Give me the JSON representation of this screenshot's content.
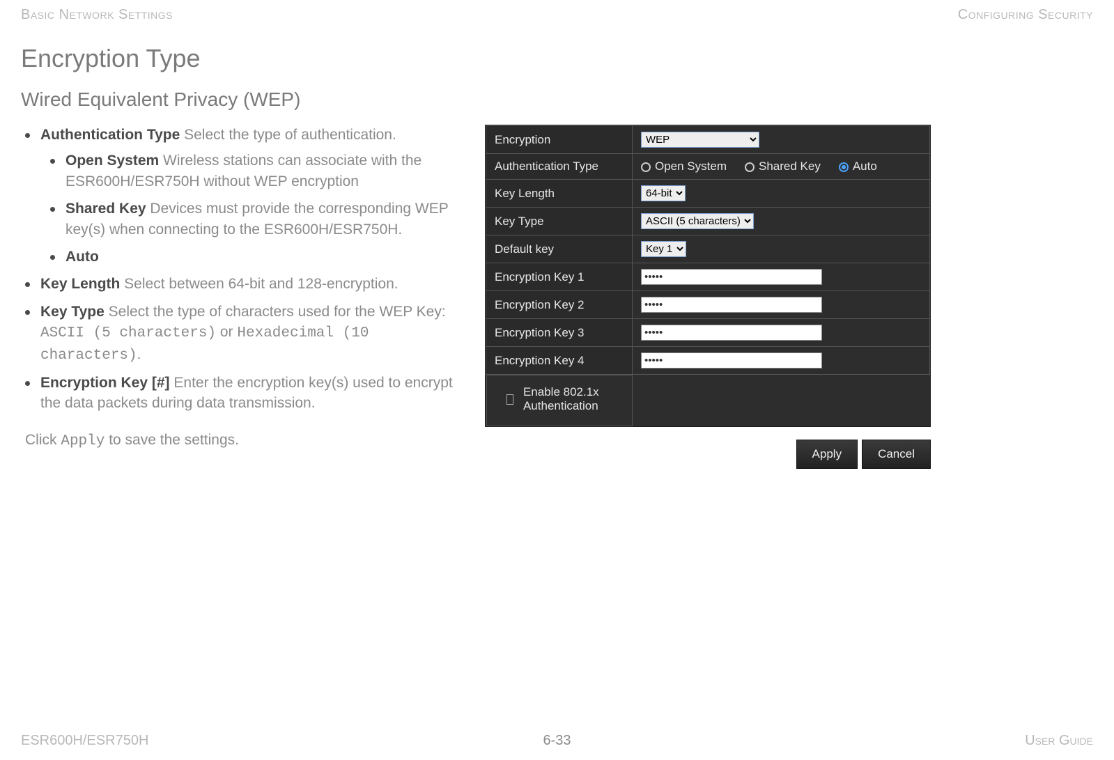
{
  "header": {
    "left": "Basic Network Settings",
    "right": "Configuring Security"
  },
  "title": "Encryption Type",
  "subtitle": "Wired Equivalent Privacy (WEP)",
  "bullets": {
    "auth_type": {
      "term": "Authentication Type",
      "desc": "  Select the type of authentication."
    },
    "open_system": {
      "term": "Open System",
      "desc": "  Wireless stations can associate with the ESR600H/ESR750H without WEP encryption"
    },
    "shared_key": {
      "term": "Shared Key",
      "desc": "  Devices must provide the corresponding WEP key(s) when connecting to the ESR600H/ESR750H."
    },
    "auto": {
      "term": "Auto"
    },
    "key_length": {
      "term": "Key Length",
      "desc": "  Select between 64-bit and 128-encryption."
    },
    "key_type": {
      "term": "Key Type",
      "desc_pre": "  Select the type of characters used for the WEP Key: ",
      "mono1": "ASCII (5 characters)",
      "mid": " or ",
      "mono2": "Hexadecimal (10 characters)",
      "tail": "."
    },
    "enc_key": {
      "term": "Encryption Key [#]",
      "desc": "  Enter the encryption key(s) used to encrypt the data packets during data transmission."
    }
  },
  "apply_note": {
    "pre": "Click ",
    "mono": "Apply",
    "post": " to save the settings."
  },
  "panel": {
    "rows": {
      "encryption": {
        "label": "Encryption",
        "value": "WEP"
      },
      "auth": {
        "label": "Authentication Type",
        "opts": [
          "Open System",
          "Shared Key",
          "Auto"
        ],
        "selected": "Auto"
      },
      "key_length": {
        "label": "Key Length",
        "value": "64-bit"
      },
      "key_type": {
        "label": "Key Type",
        "value": "ASCII (5 characters)"
      },
      "default_key": {
        "label": "Default key",
        "value": "Key 1"
      },
      "k1": {
        "label": "Encryption Key 1",
        "value": "•••••"
      },
      "k2": {
        "label": "Encryption Key 2",
        "value": "•••••"
      },
      "k3": {
        "label": "Encryption Key 3",
        "value": "•••••"
      },
      "k4": {
        "label": "Encryption Key 4",
        "value": "•••••"
      }
    },
    "checkbox_label": "Enable 802.1x Authentication",
    "buttons": {
      "apply": "Apply",
      "cancel": "Cancel"
    }
  },
  "footer": {
    "left": "ESR600H/ESR750H",
    "center": "6-33",
    "right": "User Guide"
  }
}
